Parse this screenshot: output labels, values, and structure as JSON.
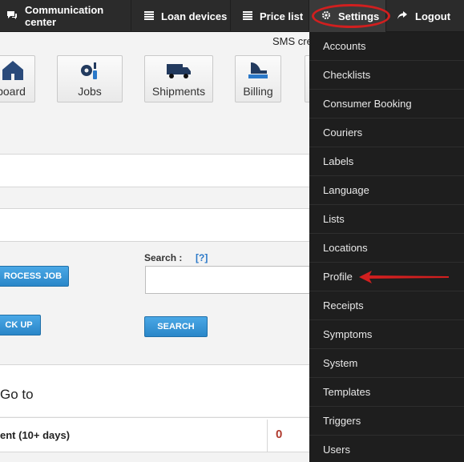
{
  "nav": {
    "communication_center": "Communication center",
    "loan_devices": "Loan devices",
    "price_list": "Price list",
    "settings": "Settings",
    "logout": "Logout"
  },
  "sms_text": "SMS cre",
  "tiles": [
    {
      "label": "board",
      "icon": "home-icon"
    },
    {
      "label": "Jobs",
      "icon": "gears-icon"
    },
    {
      "label": "Shipments",
      "icon": "truck-icon"
    },
    {
      "label": "Billing",
      "icon": "cash-register-icon"
    }
  ],
  "actions": {
    "process_job": "ROCESS JOB",
    "pick_up": "CK UP",
    "search_button": "SEARCH"
  },
  "search": {
    "label": "Search :",
    "help": "[?]",
    "value": ""
  },
  "goto_title": "Go to",
  "summary_row": {
    "label": "ent (10+ days)",
    "count": "0"
  },
  "settings_menu": [
    "Accounts",
    "Checklists",
    "Consumer Booking",
    "Couriers",
    "Labels",
    "Language",
    "Lists",
    "Locations",
    "Profile",
    "Receipts",
    "Symptoms",
    "System",
    "Templates",
    "Triggers",
    "Users"
  ],
  "colors": {
    "highlight": "#d11f1f",
    "nav_bg": "#2b2b2b",
    "menu_bg": "#1e1e1e",
    "button_blue": "#2a86c8"
  }
}
